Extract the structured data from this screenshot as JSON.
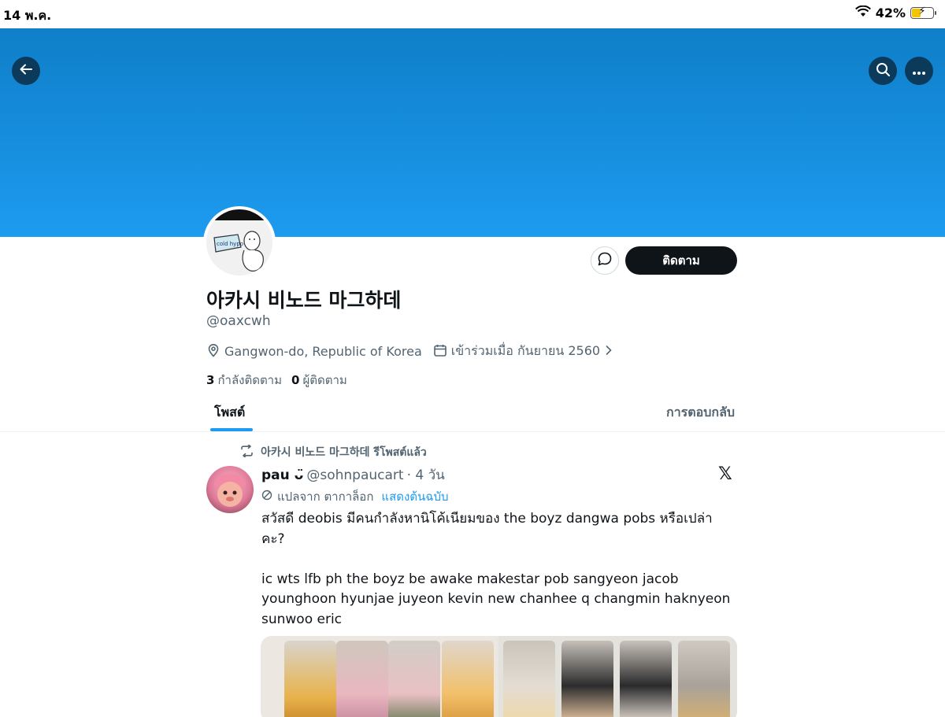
{
  "status_bar": {
    "time": "14 พ.ค.",
    "battery": "42%",
    "battery_level": 0.42
  },
  "profile": {
    "display_name": "아카시 비노드 마그하데",
    "handle": "@oaxcwh",
    "location": "Gangwon-do, Republic of Korea",
    "joined": "เข้าร่วมเมื่อ กันยายน 2560",
    "avatar_text": "cold hypo",
    "following_count": "3",
    "following_label": "กำลังติดตาม",
    "followers_count": "0",
    "followers_label": "ผู้ติดตาม",
    "follow_button": "ติดตาม"
  },
  "tabs": [
    {
      "label": "โพสต์",
      "active": true
    },
    {
      "label": "การตอบกลับ",
      "active": false
    }
  ],
  "post": {
    "repost_label": "아카시 비노드 마그하데 รีโพสต์แล้ว",
    "author_name": "pau ᴗ̈",
    "author_handle": "@sohnpaucart",
    "time": "· 4 วัน",
    "translate_label": "แปลจาก ตากาล็อก",
    "show_original": "แสดงต้นฉบับ",
    "text": "สวัสดี deobis มีคนกำลังหานิโค้เนียมของ the boyz dangwa pobs หรือเปล่าคะ?\n\nic wts lfb ph the boyz be awake makestar pob sangyeon jacob younghoon hyunjae juyeon kevin new chanhee q changmin haknyeon sunwoo eric"
  },
  "colors": {
    "accent": "#1d9bf0",
    "banner_top": "#0f7fc8",
    "follow_button_bg": "#0f1419",
    "muted_text": "#536471"
  },
  "icons": [
    "back-arrow-icon",
    "search-icon",
    "more-icon",
    "message-icon",
    "location-pin-icon",
    "calendar-icon",
    "chevron-right-icon",
    "repost-icon",
    "translate-icon",
    "x-logo-icon",
    "wifi-icon",
    "battery-icon"
  ]
}
